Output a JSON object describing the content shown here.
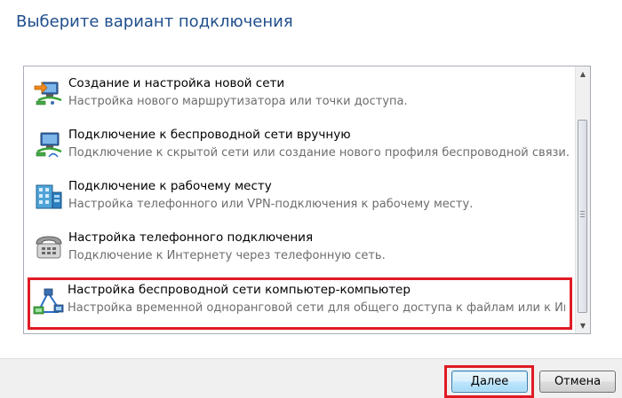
{
  "heading": "Выберите вариант подключения",
  "options": [
    {
      "icon": "network-setup-icon",
      "title": "Создание и настройка новой сети",
      "description": "Настройка нового маршрутизатора или точки доступа."
    },
    {
      "icon": "wireless-manual-icon",
      "title": "Подключение к беспроводной сети вручную",
      "description": "Подключение к скрытой сети или создание нового профиля беспроводной связи."
    },
    {
      "icon": "workplace-icon",
      "title": "Подключение к рабочему месту",
      "description": "Настройка телефонного или VPN-подключения к рабочему месту."
    },
    {
      "icon": "dialup-phone-icon",
      "title": "Настройка телефонного подключения",
      "description": "Подключение к Интернету через телефонную сеть."
    },
    {
      "icon": "ad-hoc-network-icon",
      "title": "Настройка беспроводной сети компьютер-компьютер",
      "description": "Настройка временной одноранговой сети для общего доступа к файлам или к Инт..."
    }
  ],
  "buttons": {
    "next": "Далее",
    "cancel": "Отмена"
  },
  "colors": {
    "heading": "#1f4e8c",
    "highlight": "#e01b24",
    "description": "#6d6d6d"
  }
}
